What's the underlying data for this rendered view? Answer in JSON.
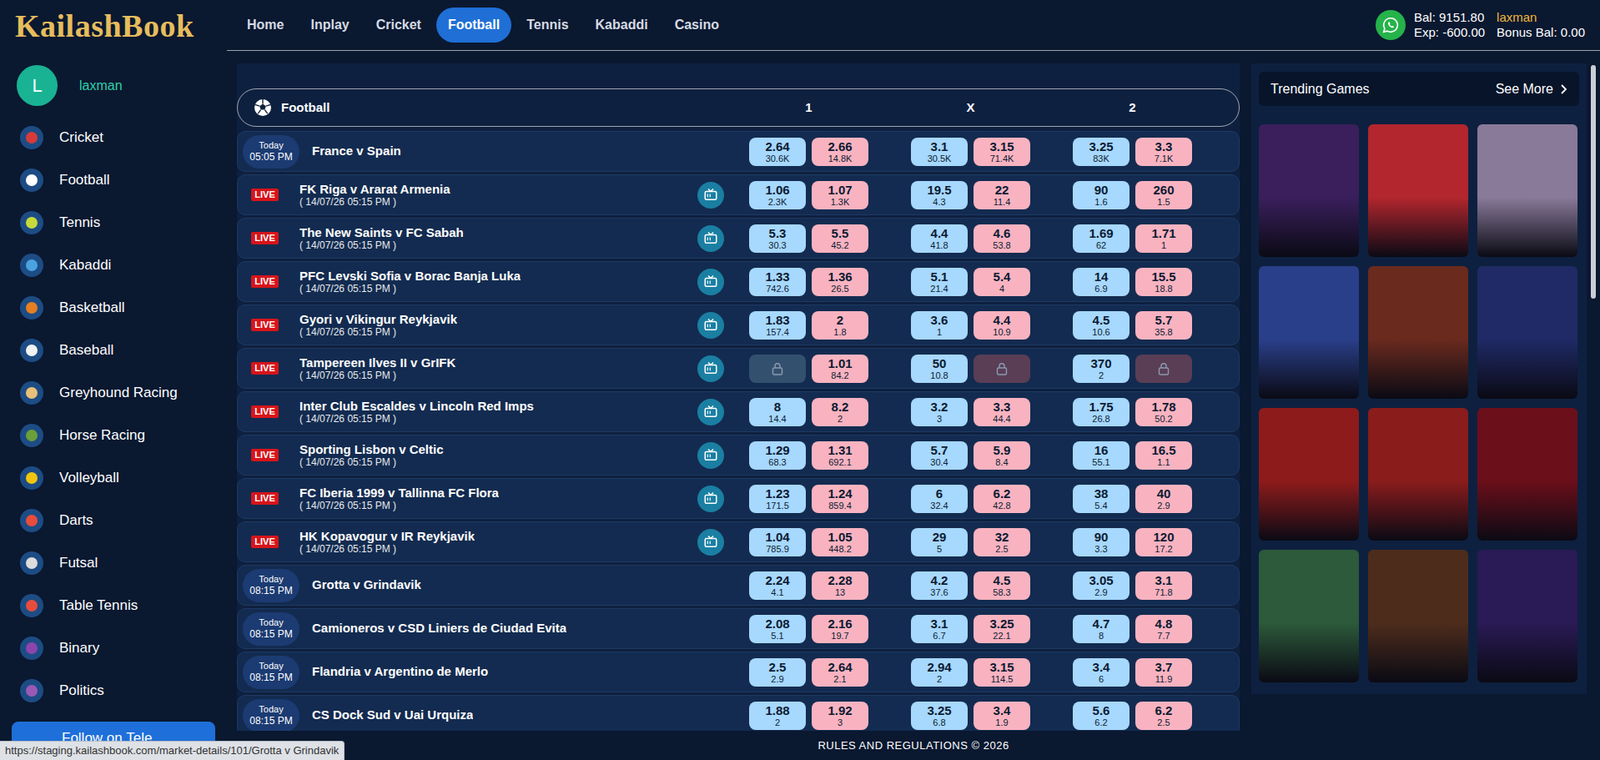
{
  "brand": {
    "logo": "KailashBook"
  },
  "nav": [
    {
      "label": "Home",
      "selected": false
    },
    {
      "label": "Inplay",
      "selected": false
    },
    {
      "label": "Cricket",
      "selected": false
    },
    {
      "label": "Football",
      "selected": true
    },
    {
      "label": "Tennis",
      "selected": false
    },
    {
      "label": "Kabaddi",
      "selected": false
    },
    {
      "label": "Casino",
      "selected": false
    }
  ],
  "account": {
    "balance": "Bal: 9151.80",
    "exposure": "Exp: -600.00",
    "username": "laxman",
    "bonus": "Bonus Bal: 0.00"
  },
  "sidebar": {
    "avatar": "L",
    "username": "laxman",
    "items": [
      {
        "label": "Cricket",
        "color": "#d63a3a"
      },
      {
        "label": "Football",
        "color": "#ffffff"
      },
      {
        "label": "Tennis",
        "color": "#c7d93a"
      },
      {
        "label": "Kabaddi",
        "color": "#4aa3df"
      },
      {
        "label": "Basketball",
        "color": "#e67e22"
      },
      {
        "label": "Baseball",
        "color": "#f2f2f2"
      },
      {
        "label": "Greyhound Racing",
        "color": "#e8c07a"
      },
      {
        "label": "Horse Racing",
        "color": "#6a9f3a"
      },
      {
        "label": "Volleyball",
        "color": "#f1c40f"
      },
      {
        "label": "Darts",
        "color": "#e74c3c"
      },
      {
        "label": "Futsal",
        "color": "#dddddd"
      },
      {
        "label": "Table Tennis",
        "color": "#e74c3c"
      },
      {
        "label": "Binary",
        "color": "#8e44ad"
      },
      {
        "label": "Politics",
        "color": "#9b59b6"
      }
    ],
    "follow_button": "Follow on Tele"
  },
  "market": {
    "title": "Football",
    "columns": [
      "1",
      "X",
      "2"
    ],
    "rows": [
      {
        "kind": "scheduled",
        "day": "Today",
        "time": "05:05 PM",
        "name": "France v Spain",
        "has_tv": false,
        "odds": [
          {
            "price": "2.64",
            "size": "30.6K",
            "locked": false
          },
          {
            "price": "2.66",
            "size": "14.8K",
            "locked": false
          },
          {
            "price": "3.1",
            "size": "30.5K",
            "locked": false
          },
          {
            "price": "3.15",
            "size": "71.4K",
            "locked": false
          },
          {
            "price": "3.25",
            "size": "83K",
            "locked": false
          },
          {
            "price": "3.3",
            "size": "7.1K",
            "locked": false
          }
        ]
      },
      {
        "kind": "live",
        "badge": "LIVE",
        "date": "( 14/07/26 05:15 PM )",
        "name": "FK Riga v Ararat Armenia",
        "has_tv": true,
        "odds": [
          {
            "price": "1.06",
            "size": "2.3K",
            "locked": false
          },
          {
            "price": "1.07",
            "size": "1.3K",
            "locked": false
          },
          {
            "price": "19.5",
            "size": "4.3",
            "locked": false
          },
          {
            "price": "22",
            "size": "11.4",
            "locked": false
          },
          {
            "price": "90",
            "size": "1.6",
            "locked": false
          },
          {
            "price": "260",
            "size": "1.5",
            "locked": false
          }
        ]
      },
      {
        "kind": "live",
        "badge": "LIVE",
        "date": "( 14/07/26 05:15 PM )",
        "name": "The New Saints v FC Sabah",
        "has_tv": true,
        "odds": [
          {
            "price": "5.3",
            "size": "30.3",
            "locked": false
          },
          {
            "price": "5.5",
            "size": "45.2",
            "locked": false
          },
          {
            "price": "4.4",
            "size": "41.8",
            "locked": false
          },
          {
            "price": "4.6",
            "size": "53.8",
            "locked": false
          },
          {
            "price": "1.69",
            "size": "62",
            "locked": false
          },
          {
            "price": "1.71",
            "size": "1",
            "locked": false
          }
        ]
      },
      {
        "kind": "live",
        "badge": "LIVE",
        "date": "( 14/07/26 05:15 PM )",
        "name": "PFC Levski Sofia v Borac Banja Luka",
        "has_tv": true,
        "odds": [
          {
            "price": "1.33",
            "size": "742.6",
            "locked": false
          },
          {
            "price": "1.36",
            "size": "26.5",
            "locked": false
          },
          {
            "price": "5.1",
            "size": "21.4",
            "locked": false
          },
          {
            "price": "5.4",
            "size": "4",
            "locked": false
          },
          {
            "price": "14",
            "size": "6.9",
            "locked": false
          },
          {
            "price": "15.5",
            "size": "18.8",
            "locked": false
          }
        ]
      },
      {
        "kind": "live",
        "badge": "LIVE",
        "date": "( 14/07/26 05:15 PM )",
        "name": "Gyori v Vikingur Reykjavik",
        "has_tv": true,
        "odds": [
          {
            "price": "1.83",
            "size": "157.4",
            "locked": false
          },
          {
            "price": "2",
            "size": "1.8",
            "locked": false
          },
          {
            "price": "3.6",
            "size": "1",
            "locked": false
          },
          {
            "price": "4.4",
            "size": "10.9",
            "locked": false
          },
          {
            "price": "4.5",
            "size": "10.6",
            "locked": false
          },
          {
            "price": "5.7",
            "size": "35.8",
            "locked": false
          }
        ]
      },
      {
        "kind": "live",
        "badge": "LIVE",
        "date": "( 14/07/26 05:15 PM )",
        "name": "Tampereen Ilves II v GrIFK",
        "has_tv": true,
        "odds": [
          {
            "price": "",
            "size": "",
            "locked": true
          },
          {
            "price": "1.01",
            "size": "84.2",
            "locked": false
          },
          {
            "price": "50",
            "size": "10.8",
            "locked": false
          },
          {
            "price": "",
            "size": "",
            "locked": true
          },
          {
            "price": "370",
            "size": "2",
            "locked": false
          },
          {
            "price": "",
            "size": "",
            "locked": true
          }
        ]
      },
      {
        "kind": "live",
        "badge": "LIVE",
        "date": "( 14/07/26 05:15 PM )",
        "name": "Inter Club Escaldes v Lincoln Red Imps",
        "has_tv": true,
        "odds": [
          {
            "price": "8",
            "size": "14.4",
            "locked": false
          },
          {
            "price": "8.2",
            "size": "2",
            "locked": false
          },
          {
            "price": "3.2",
            "size": "3",
            "locked": false
          },
          {
            "price": "3.3",
            "size": "44.4",
            "locked": false
          },
          {
            "price": "1.75",
            "size": "26.8",
            "locked": false
          },
          {
            "price": "1.78",
            "size": "50.2",
            "locked": false
          }
        ]
      },
      {
        "kind": "live",
        "badge": "LIVE",
        "date": "( 14/07/26 05:15 PM )",
        "name": "Sporting Lisbon v Celtic",
        "has_tv": true,
        "odds": [
          {
            "price": "1.29",
            "size": "68.3",
            "locked": false
          },
          {
            "price": "1.31",
            "size": "692.1",
            "locked": false
          },
          {
            "price": "5.7",
            "size": "30.4",
            "locked": false
          },
          {
            "price": "5.9",
            "size": "8.4",
            "locked": false
          },
          {
            "price": "16",
            "size": "55.1",
            "locked": false
          },
          {
            "price": "16.5",
            "size": "1.1",
            "locked": false
          }
        ]
      },
      {
        "kind": "live",
        "badge": "LIVE",
        "date": "( 14/07/26 05:15 PM )",
        "name": "FC Iberia 1999 v Tallinna FC Flora",
        "has_tv": true,
        "odds": [
          {
            "price": "1.23",
            "size": "171.5",
            "locked": false
          },
          {
            "price": "1.24",
            "size": "859.4",
            "locked": false
          },
          {
            "price": "6",
            "size": "32.4",
            "locked": false
          },
          {
            "price": "6.2",
            "size": "42.8",
            "locked": false
          },
          {
            "price": "38",
            "size": "5.4",
            "locked": false
          },
          {
            "price": "40",
            "size": "2.9",
            "locked": false
          }
        ]
      },
      {
        "kind": "live",
        "badge": "LIVE",
        "date": "( 14/07/26 05:15 PM )",
        "name": "HK Kopavogur v IR Reykjavik",
        "has_tv": true,
        "odds": [
          {
            "price": "1.04",
            "size": "785.9",
            "locked": false
          },
          {
            "price": "1.05",
            "size": "448.2",
            "locked": false
          },
          {
            "price": "29",
            "size": "5",
            "locked": false
          },
          {
            "price": "32",
            "size": "2.5",
            "locked": false
          },
          {
            "price": "90",
            "size": "3.3",
            "locked": false
          },
          {
            "price": "120",
            "size": "17.2",
            "locked": false
          }
        ]
      },
      {
        "kind": "scheduled",
        "day": "Today",
        "time": "08:15 PM",
        "name": "Grotta v Grindavik",
        "has_tv": false,
        "odds": [
          {
            "price": "2.24",
            "size": "4.1",
            "locked": false
          },
          {
            "price": "2.28",
            "size": "13",
            "locked": false
          },
          {
            "price": "4.2",
            "size": "37.6",
            "locked": false
          },
          {
            "price": "4.5",
            "size": "58.3",
            "locked": false
          },
          {
            "price": "3.05",
            "size": "2.9",
            "locked": false
          },
          {
            "price": "3.1",
            "size": "71.8",
            "locked": false
          }
        ]
      },
      {
        "kind": "scheduled",
        "day": "Today",
        "time": "08:15 PM",
        "name": "Camioneros v CSD Liniers de Ciudad Evita",
        "has_tv": false,
        "odds": [
          {
            "price": "2.08",
            "size": "5.1",
            "locked": false
          },
          {
            "price": "2.16",
            "size": "19.7",
            "locked": false
          },
          {
            "price": "3.1",
            "size": "6.7",
            "locked": false
          },
          {
            "price": "3.25",
            "size": "22.1",
            "locked": false
          },
          {
            "price": "4.7",
            "size": "8",
            "locked": false
          },
          {
            "price": "4.8",
            "size": "7.7",
            "locked": false
          }
        ]
      },
      {
        "kind": "scheduled",
        "day": "Today",
        "time": "08:15 PM",
        "name": "Flandria v Argentino de Merlo",
        "has_tv": false,
        "odds": [
          {
            "price": "2.5",
            "size": "2.9",
            "locked": false
          },
          {
            "price": "2.64",
            "size": "2.1",
            "locked": false
          },
          {
            "price": "2.94",
            "size": "2",
            "locked": false
          },
          {
            "price": "3.15",
            "size": "114.5",
            "locked": false
          },
          {
            "price": "3.4",
            "size": "6",
            "locked": false
          },
          {
            "price": "3.7",
            "size": "11.9",
            "locked": false
          }
        ]
      },
      {
        "kind": "scheduled",
        "day": "Today",
        "time": "08:15 PM",
        "name": "CS Dock Sud v Uai Urquiza",
        "has_tv": false,
        "odds": [
          {
            "price": "1.88",
            "size": "2",
            "locked": false
          },
          {
            "price": "1.92",
            "size": "3",
            "locked": false
          },
          {
            "price": "3.25",
            "size": "6.8",
            "locked": false
          },
          {
            "price": "3.4",
            "size": "1.9",
            "locked": false
          },
          {
            "price": "5.6",
            "size": "6.2",
            "locked": false
          },
          {
            "price": "6.2",
            "size": "2.5",
            "locked": false
          }
        ]
      }
    ]
  },
  "trending": {
    "title": "Trending Games",
    "see_more": "See More",
    "games": [
      {
        "color": "#3a1f5c"
      },
      {
        "color": "#b3262e"
      },
      {
        "color": "#8a7a9a"
      },
      {
        "color": "#2a3f8a"
      },
      {
        "color": "#6a2a1e"
      },
      {
        "color": "#1f2a66"
      },
      {
        "color": "#8e1b1b"
      },
      {
        "color": "#8a1c1c"
      },
      {
        "color": "#6b0f1a"
      },
      {
        "color": "#2c5a3a"
      },
      {
        "color": "#4d2c1c"
      },
      {
        "color": "#2a1a55"
      }
    ]
  },
  "footer": {
    "text": "RULES AND REGULATIONS © 2026"
  },
  "status_bar": {
    "url": "https://staging.kailashbook.com/market-details/101/Grotta v Grindavik"
  }
}
